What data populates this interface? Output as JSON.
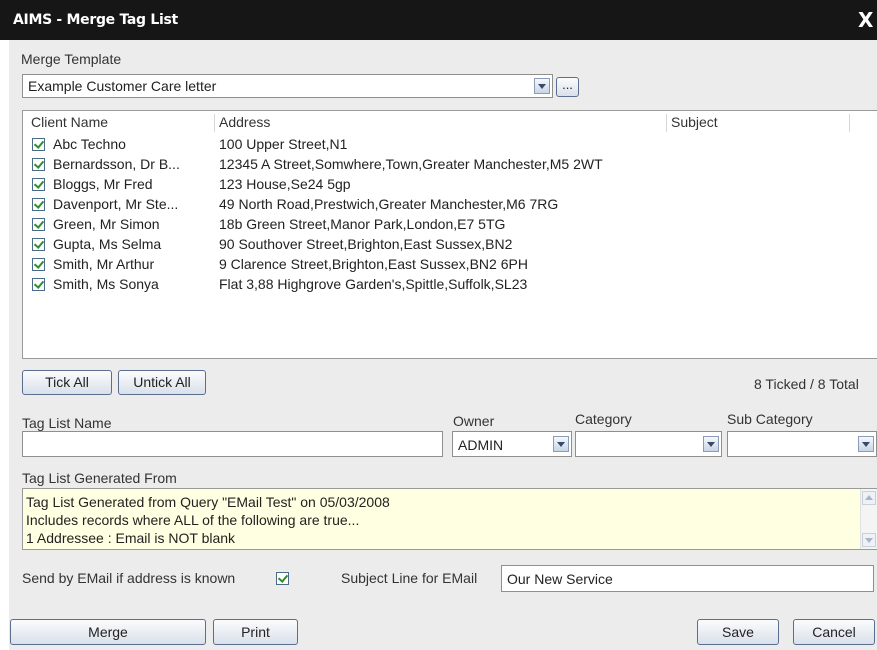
{
  "window": {
    "title": "AIMS - Merge Tag List",
    "close_glyph": "X"
  },
  "merge_template": {
    "label": "Merge Template",
    "value": "Example Customer Care letter",
    "browse_label": "..."
  },
  "list": {
    "columns": [
      "Client Name",
      "Address",
      "Subject"
    ],
    "rows": [
      {
        "checked": true,
        "name": "Abc Techno",
        "address": "100 Upper Street,N1",
        "subject": ""
      },
      {
        "checked": true,
        "name": "Bernardsson, Dr B...",
        "address": "12345 A Street,Somwhere,Town,Greater Manchester,M5 2WT",
        "subject": ""
      },
      {
        "checked": true,
        "name": "Bloggs, Mr Fred",
        "address": "123 House,Se24 5gp",
        "subject": ""
      },
      {
        "checked": true,
        "name": "Davenport, Mr Ste...",
        "address": "49 North Road,Prestwich,Greater Manchester,M6 7RG",
        "subject": ""
      },
      {
        "checked": true,
        "name": "Green, Mr Simon",
        "address": "18b Green Street,Manor Park,London,E7 5TG",
        "subject": ""
      },
      {
        "checked": true,
        "name": "Gupta, Ms Selma",
        "address": "90 Southover Street,Brighton,East Sussex,BN2",
        "subject": ""
      },
      {
        "checked": true,
        "name": "Smith, Mr Arthur",
        "address": "9 Clarence Street,Brighton,East Sussex,BN2 6PH",
        "subject": ""
      },
      {
        "checked": true,
        "name": "Smith, Ms Sonya",
        "address": "Flat 3,88 Highgrove Garden's,Spittle,Suffolk,SL23",
        "subject": ""
      }
    ]
  },
  "tick_all_label": "Tick All",
  "untick_all_label": "Untick All",
  "tick_count": "8 Ticked / 8 Total",
  "tag_list_name": {
    "label": "Tag List Name",
    "value": ""
  },
  "owner": {
    "label": "Owner",
    "value": "ADMIN"
  },
  "category": {
    "label": "Category",
    "value": ""
  },
  "sub_category": {
    "label": "Sub Category",
    "value": ""
  },
  "generated_from": {
    "label": "Tag List Generated From",
    "lines": [
      "Tag List Generated from Query \"EMail Test\" on 05/03/2008",
      "Includes records where ALL of the following are true...",
      "1  Addressee : Email is NOT blank"
    ]
  },
  "send_by_email": {
    "label": "Send by EMail if address is known",
    "checked": true
  },
  "subject_line": {
    "label": "Subject Line for EMail",
    "value": "Our New Service"
  },
  "buttons": {
    "merge": "Merge",
    "print": "Print",
    "save": "Save",
    "cancel": "Cancel"
  },
  "colors": {
    "titlebar": "#161616",
    "window_bg": "#ececec",
    "memo_bg": "#ffffe1",
    "check": "#2e8b2e"
  }
}
